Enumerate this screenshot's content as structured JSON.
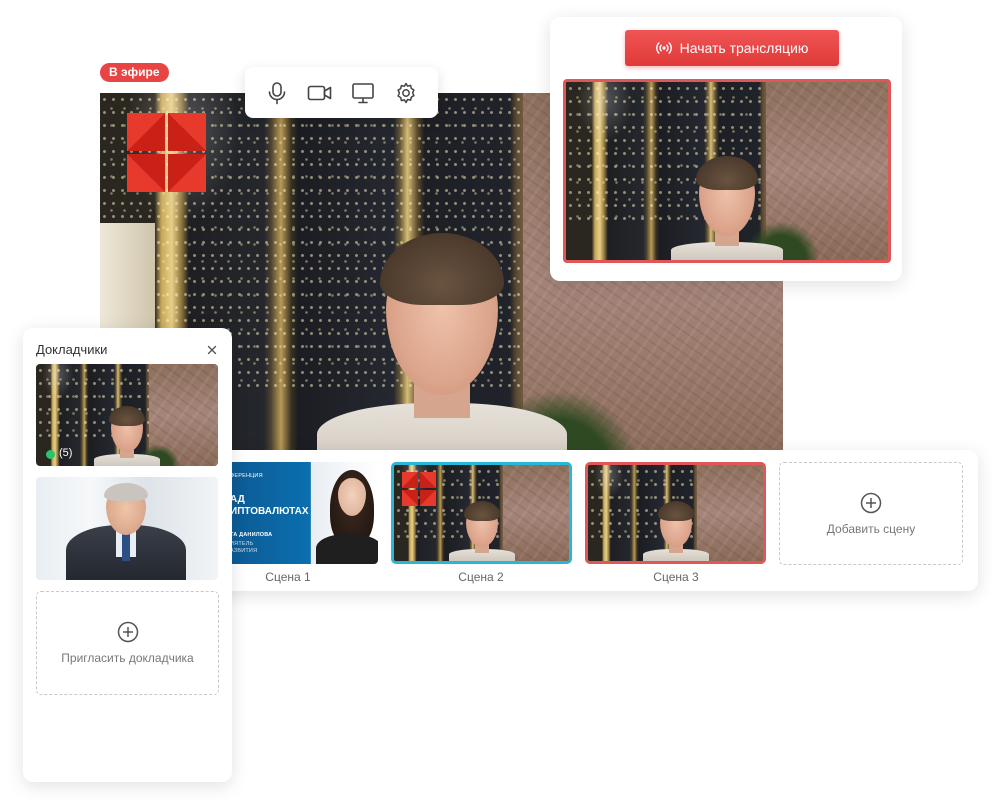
{
  "live_badge": "В эфире",
  "toolbar": {
    "icons": [
      "microphone-icon",
      "camera-icon",
      "screen-share-icon",
      "settings-icon"
    ]
  },
  "broadcast": {
    "start_label": "Начать трансляцию",
    "icon": "broadcast-icon"
  },
  "speakers": {
    "title": "Докладчики",
    "close_icon": "close-icon",
    "speaker1_count": "(5)",
    "invite_label": "Пригласить докладчика"
  },
  "scenes": {
    "items": [
      {
        "label": "Сцена 1",
        "slide": {
          "small_top": "ФЕРЕНЦИЯ",
          "big_line1": "АД",
          "big_line2": "ИПТОВАЛЮТАХ",
          "name": "ТА ДАНИЛОВА",
          "sub1": "ИЯТЕЛЬ",
          "sub2": "АЗВИТИЯ"
        }
      },
      {
        "label": "Сцена 2"
      },
      {
        "label": "Сцена 3"
      }
    ],
    "add_label": "Добавить сцену"
  },
  "colors": {
    "accent_red": "#e84444",
    "selected_cyan": "#28b8d6",
    "live_green": "#2bc46a"
  }
}
